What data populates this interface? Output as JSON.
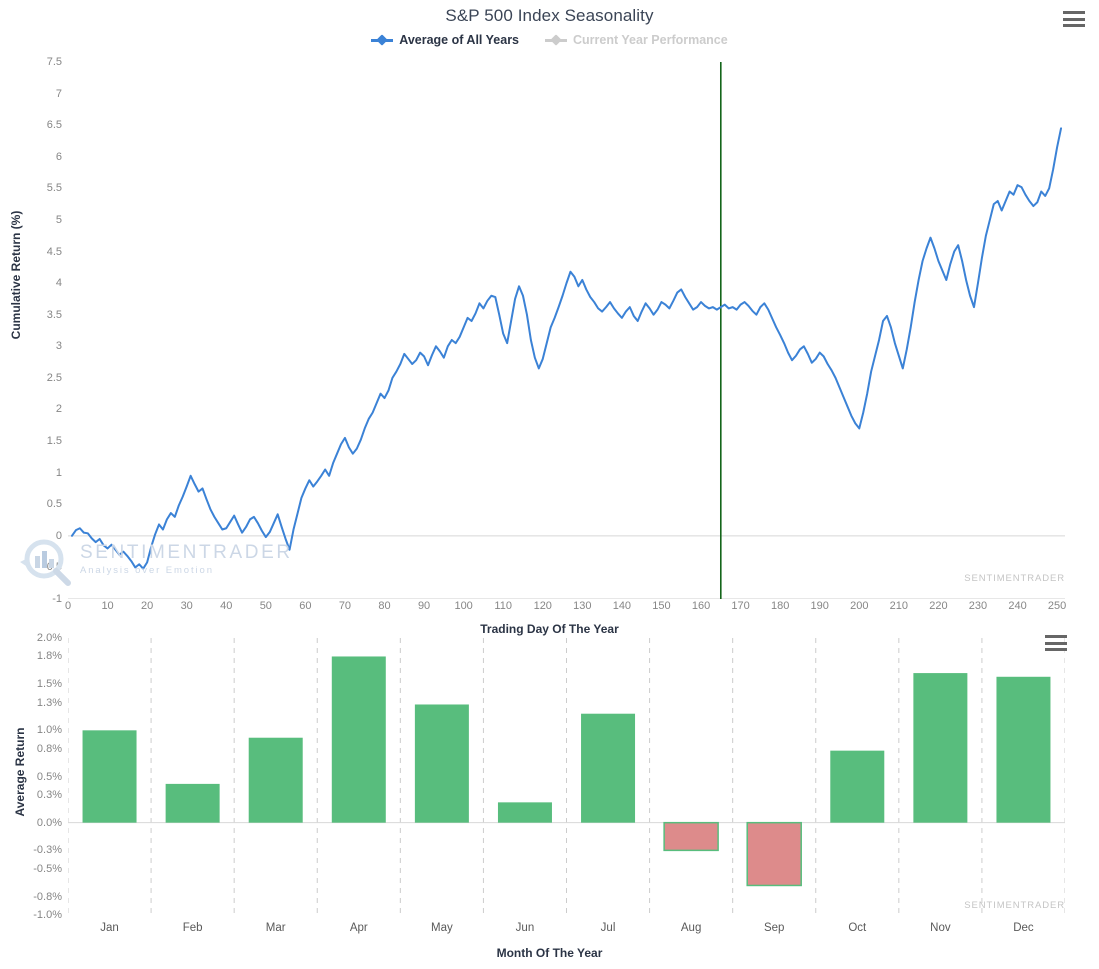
{
  "header": {
    "title": "S&P 500 Index Seasonality",
    "menu_icon": "hamburger-menu-icon"
  },
  "legend": {
    "items": [
      {
        "label": "Average of All Years",
        "color": "#3b82d6",
        "state": "active"
      },
      {
        "label": "Current Year Performance",
        "color": "#cccccc",
        "state": "inactive"
      }
    ]
  },
  "watermark": {
    "title": "SENTIMENTRADER",
    "subtitle": "Analysis over Emotion",
    "icon": "magnifier-bars-logo-icon"
  },
  "credits": {
    "top": "SENTIMENTRADER",
    "bottom": "SENTIMENTRADER"
  },
  "chart_data": [
    {
      "type": "line",
      "title": "S&P 500 Index Seasonality",
      "xlabel": "Trading Day Of The Year",
      "ylabel": "Cumulative Return (%)",
      "xlim": [
        0,
        252
      ],
      "ylim": [
        -1,
        7.5
      ],
      "xticks": [
        0,
        10,
        20,
        30,
        40,
        50,
        60,
        70,
        80,
        90,
        100,
        110,
        120,
        130,
        140,
        150,
        160,
        170,
        180,
        190,
        200,
        210,
        220,
        230,
        240,
        250
      ],
      "yticks": [
        -1,
        -0.5,
        0,
        0.5,
        1,
        1.5,
        2,
        2.5,
        3,
        3.5,
        4,
        4.5,
        5,
        5.5,
        6,
        6.5,
        7,
        7.5
      ],
      "grid": false,
      "zero_line": 0,
      "marker_line": {
        "x": 165,
        "color": "#14651a",
        "label": "current-day-marker"
      },
      "series": [
        {
          "name": "Average of All Years",
          "color": "#3b82d6",
          "x": [
            1,
            2,
            3,
            4,
            5,
            6,
            7,
            8,
            9,
            10,
            11,
            12,
            13,
            14,
            15,
            16,
            17,
            18,
            19,
            20,
            21,
            22,
            23,
            24,
            25,
            26,
            27,
            28,
            29,
            30,
            31,
            32,
            33,
            34,
            35,
            36,
            37,
            38,
            39,
            40,
            41,
            42,
            43,
            44,
            45,
            46,
            47,
            48,
            49,
            50,
            51,
            52,
            53,
            54,
            55,
            56,
            57,
            58,
            59,
            60,
            61,
            62,
            63,
            64,
            65,
            66,
            67,
            68,
            69,
            70,
            71,
            72,
            73,
            74,
            75,
            76,
            77,
            78,
            79,
            80,
            81,
            82,
            83,
            84,
            85,
            86,
            87,
            88,
            89,
            90,
            91,
            92,
            93,
            94,
            95,
            96,
            97,
            98,
            99,
            100,
            101,
            102,
            103,
            104,
            105,
            106,
            107,
            108,
            109,
            110,
            111,
            112,
            113,
            114,
            115,
            116,
            117,
            118,
            119,
            120,
            121,
            122,
            123,
            124,
            125,
            126,
            127,
            128,
            129,
            130,
            131,
            132,
            133,
            134,
            135,
            136,
            137,
            138,
            139,
            140,
            141,
            142,
            143,
            144,
            145,
            146,
            147,
            148,
            149,
            150,
            151,
            152,
            153,
            154,
            155,
            156,
            157,
            158,
            159,
            160,
            161,
            162,
            163,
            164,
            165,
            166,
            167,
            168,
            169,
            170,
            171,
            172,
            173,
            174,
            175,
            176,
            177,
            178,
            179,
            180,
            181,
            182,
            183,
            184,
            185,
            186,
            187,
            188,
            189,
            190,
            191,
            192,
            193,
            194,
            195,
            196,
            197,
            198,
            199,
            200,
            201,
            202,
            203,
            204,
            205,
            206,
            207,
            208,
            209,
            210,
            211,
            212,
            213,
            214,
            215,
            216,
            217,
            218,
            219,
            220,
            221,
            222,
            223,
            224,
            225,
            226,
            227,
            228,
            229,
            230,
            231,
            232,
            233,
            234,
            235,
            236,
            237,
            238,
            239,
            240,
            241,
            242,
            243,
            244,
            245,
            246,
            247,
            248,
            249,
            250,
            251
          ],
          "y": [
            0.0,
            0.09,
            0.12,
            0.05,
            0.04,
            -0.04,
            -0.1,
            -0.05,
            -0.15,
            -0.2,
            -0.14,
            -0.22,
            -0.3,
            -0.25,
            -0.32,
            -0.4,
            -0.5,
            -0.45,
            -0.52,
            -0.42,
            -0.18,
            0.02,
            0.18,
            0.1,
            0.26,
            0.36,
            0.3,
            0.48,
            0.62,
            0.78,
            0.95,
            0.82,
            0.7,
            0.75,
            0.58,
            0.42,
            0.3,
            0.2,
            0.1,
            0.12,
            0.22,
            0.32,
            0.18,
            0.05,
            0.14,
            0.26,
            0.3,
            0.2,
            0.08,
            -0.02,
            0.06,
            0.2,
            0.34,
            0.14,
            -0.05,
            -0.22,
            0.1,
            0.35,
            0.6,
            0.75,
            0.88,
            0.78,
            0.86,
            0.95,
            1.05,
            0.95,
            1.15,
            1.3,
            1.45,
            1.55,
            1.4,
            1.3,
            1.38,
            1.52,
            1.7,
            1.85,
            1.95,
            2.1,
            2.25,
            2.18,
            2.3,
            2.5,
            2.6,
            2.72,
            2.88,
            2.8,
            2.72,
            2.78,
            2.9,
            2.84,
            2.7,
            2.86,
            3.0,
            2.92,
            2.82,
            3.0,
            3.1,
            3.05,
            3.15,
            3.3,
            3.45,
            3.4,
            3.52,
            3.68,
            3.6,
            3.72,
            3.8,
            3.78,
            3.5,
            3.2,
            3.05,
            3.4,
            3.75,
            3.95,
            3.8,
            3.5,
            3.1,
            2.82,
            2.65,
            2.8,
            3.05,
            3.3,
            3.45,
            3.62,
            3.8,
            4.0,
            4.18,
            4.1,
            3.95,
            4.05,
            3.9,
            3.78,
            3.7,
            3.6,
            3.55,
            3.62,
            3.7,
            3.6,
            3.52,
            3.45,
            3.55,
            3.62,
            3.48,
            3.4,
            3.55,
            3.68,
            3.6,
            3.5,
            3.58,
            3.7,
            3.66,
            3.6,
            3.72,
            3.85,
            3.9,
            3.78,
            3.68,
            3.58,
            3.62,
            3.7,
            3.64,
            3.6,
            3.62,
            3.58,
            3.62,
            3.66,
            3.6,
            3.62,
            3.58,
            3.66,
            3.7,
            3.64,
            3.56,
            3.5,
            3.62,
            3.68,
            3.58,
            3.44,
            3.3,
            3.18,
            3.05,
            2.9,
            2.78,
            2.85,
            2.95,
            3.0,
            2.88,
            2.74,
            2.8,
            2.9,
            2.84,
            2.72,
            2.62,
            2.5,
            2.35,
            2.2,
            2.05,
            1.9,
            1.78,
            1.7,
            1.95,
            2.25,
            2.6,
            2.85,
            3.1,
            3.4,
            3.48,
            3.3,
            3.05,
            2.85,
            2.65,
            2.95,
            3.3,
            3.7,
            4.05,
            4.35,
            4.55,
            4.72,
            4.55,
            4.35,
            4.2,
            4.05,
            4.3,
            4.5,
            4.6,
            4.35,
            4.05,
            3.8,
            3.62,
            4.0,
            4.4,
            4.75,
            5.0,
            5.25,
            5.3,
            5.15,
            5.3,
            5.45,
            5.4,
            5.55,
            5.52,
            5.4,
            5.3,
            5.22,
            5.28,
            5.45,
            5.38,
            5.5,
            5.8,
            6.15,
            6.45,
            6.68,
            6.55
          ]
        },
        {
          "name": "Current Year Performance",
          "color": "#cccccc",
          "x": [],
          "y": []
        }
      ]
    },
    {
      "type": "bar",
      "xlabel": "Month Of The Year",
      "ylabel": "Average Return",
      "categories": [
        "Jan",
        "Feb",
        "Mar",
        "Apr",
        "May",
        "Jun",
        "Jul",
        "Aug",
        "Sep",
        "Oct",
        "Nov",
        "Dec"
      ],
      "values": [
        1.0,
        0.42,
        0.92,
        1.8,
        1.28,
        0.22,
        1.18,
        -0.3,
        -0.68,
        0.78,
        1.62,
        1.58
      ],
      "value_labels": [
        "1.00%",
        "0.42%",
        "0.92%",
        "1.80%",
        "1.28%",
        "0.22%",
        "1.18%",
        "-0.30%",
        "-0.68%",
        "0.78%",
        "1.62%",
        "1.58%"
      ],
      "ylim": [
        -1.0,
        2.0
      ],
      "yticks": [
        2.0,
        1.8,
        1.5,
        1.3,
        1.0,
        0.8,
        0.5,
        0.3,
        0.0,
        -0.3,
        -0.5,
        -0.8,
        -1.0
      ],
      "ytick_labels": [
        "2.0%",
        "1.8%",
        "1.5%",
        "1.3%",
        "1.0%",
        "0.8%",
        "0.5%",
        "0.3%",
        "0.0%",
        "-0.3%",
        "-0.5%",
        "-0.8%",
        "-1.0%"
      ],
      "grid": true,
      "positive_color": "#58bd7d",
      "negative_color": "#dd8b8b",
      "negative_border_color": "#58bd7d",
      "menu_icon": "hamburger-menu-icon"
    }
  ]
}
